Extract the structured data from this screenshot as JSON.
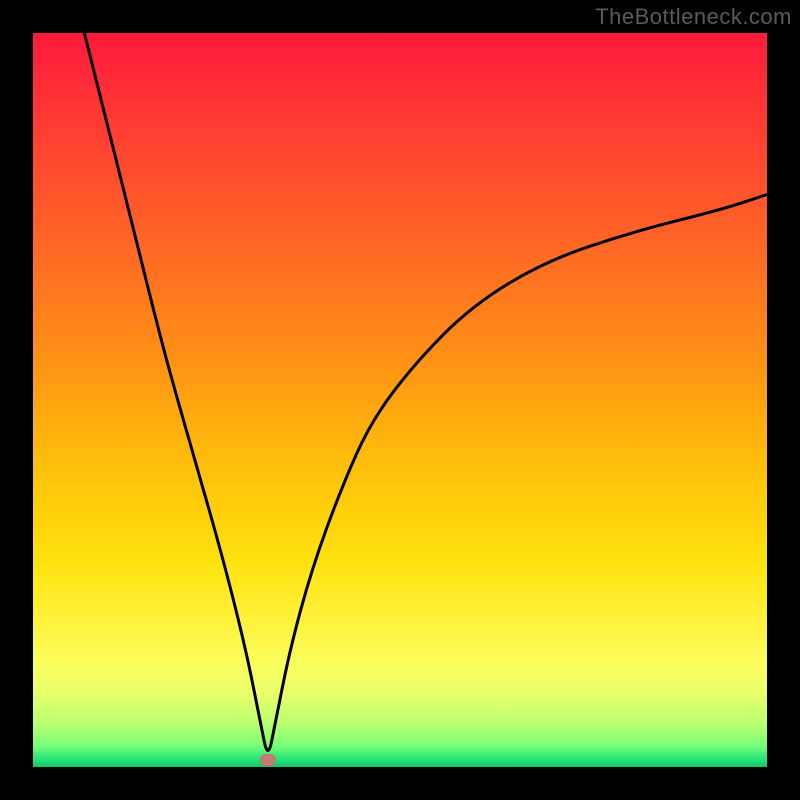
{
  "watermark": "TheBottleneck.com",
  "colors": {
    "background": "#000000",
    "gradient_top": "#ff1a3b",
    "gradient_bottom": "#15c566",
    "curve": "#000000",
    "marker": "#c97b77"
  },
  "chart_data": {
    "type": "line",
    "title": "",
    "xlabel": "",
    "ylabel": "",
    "xlim": [
      0,
      100
    ],
    "ylim": [
      0,
      100
    ],
    "grid": false,
    "legend": false,
    "marker": {
      "x": 32,
      "y": 1
    },
    "series": [
      {
        "name": "curve",
        "x": [
          7,
          10,
          14,
          18,
          22,
          26,
          29,
          31,
          32,
          33,
          35,
          38,
          42,
          46,
          52,
          60,
          70,
          82,
          94,
          100
        ],
        "y": [
          100,
          88,
          72,
          56,
          42,
          28,
          16,
          6,
          1,
          6,
          16,
          27,
          38,
          47,
          55,
          63,
          69,
          73,
          76,
          78
        ]
      }
    ]
  }
}
